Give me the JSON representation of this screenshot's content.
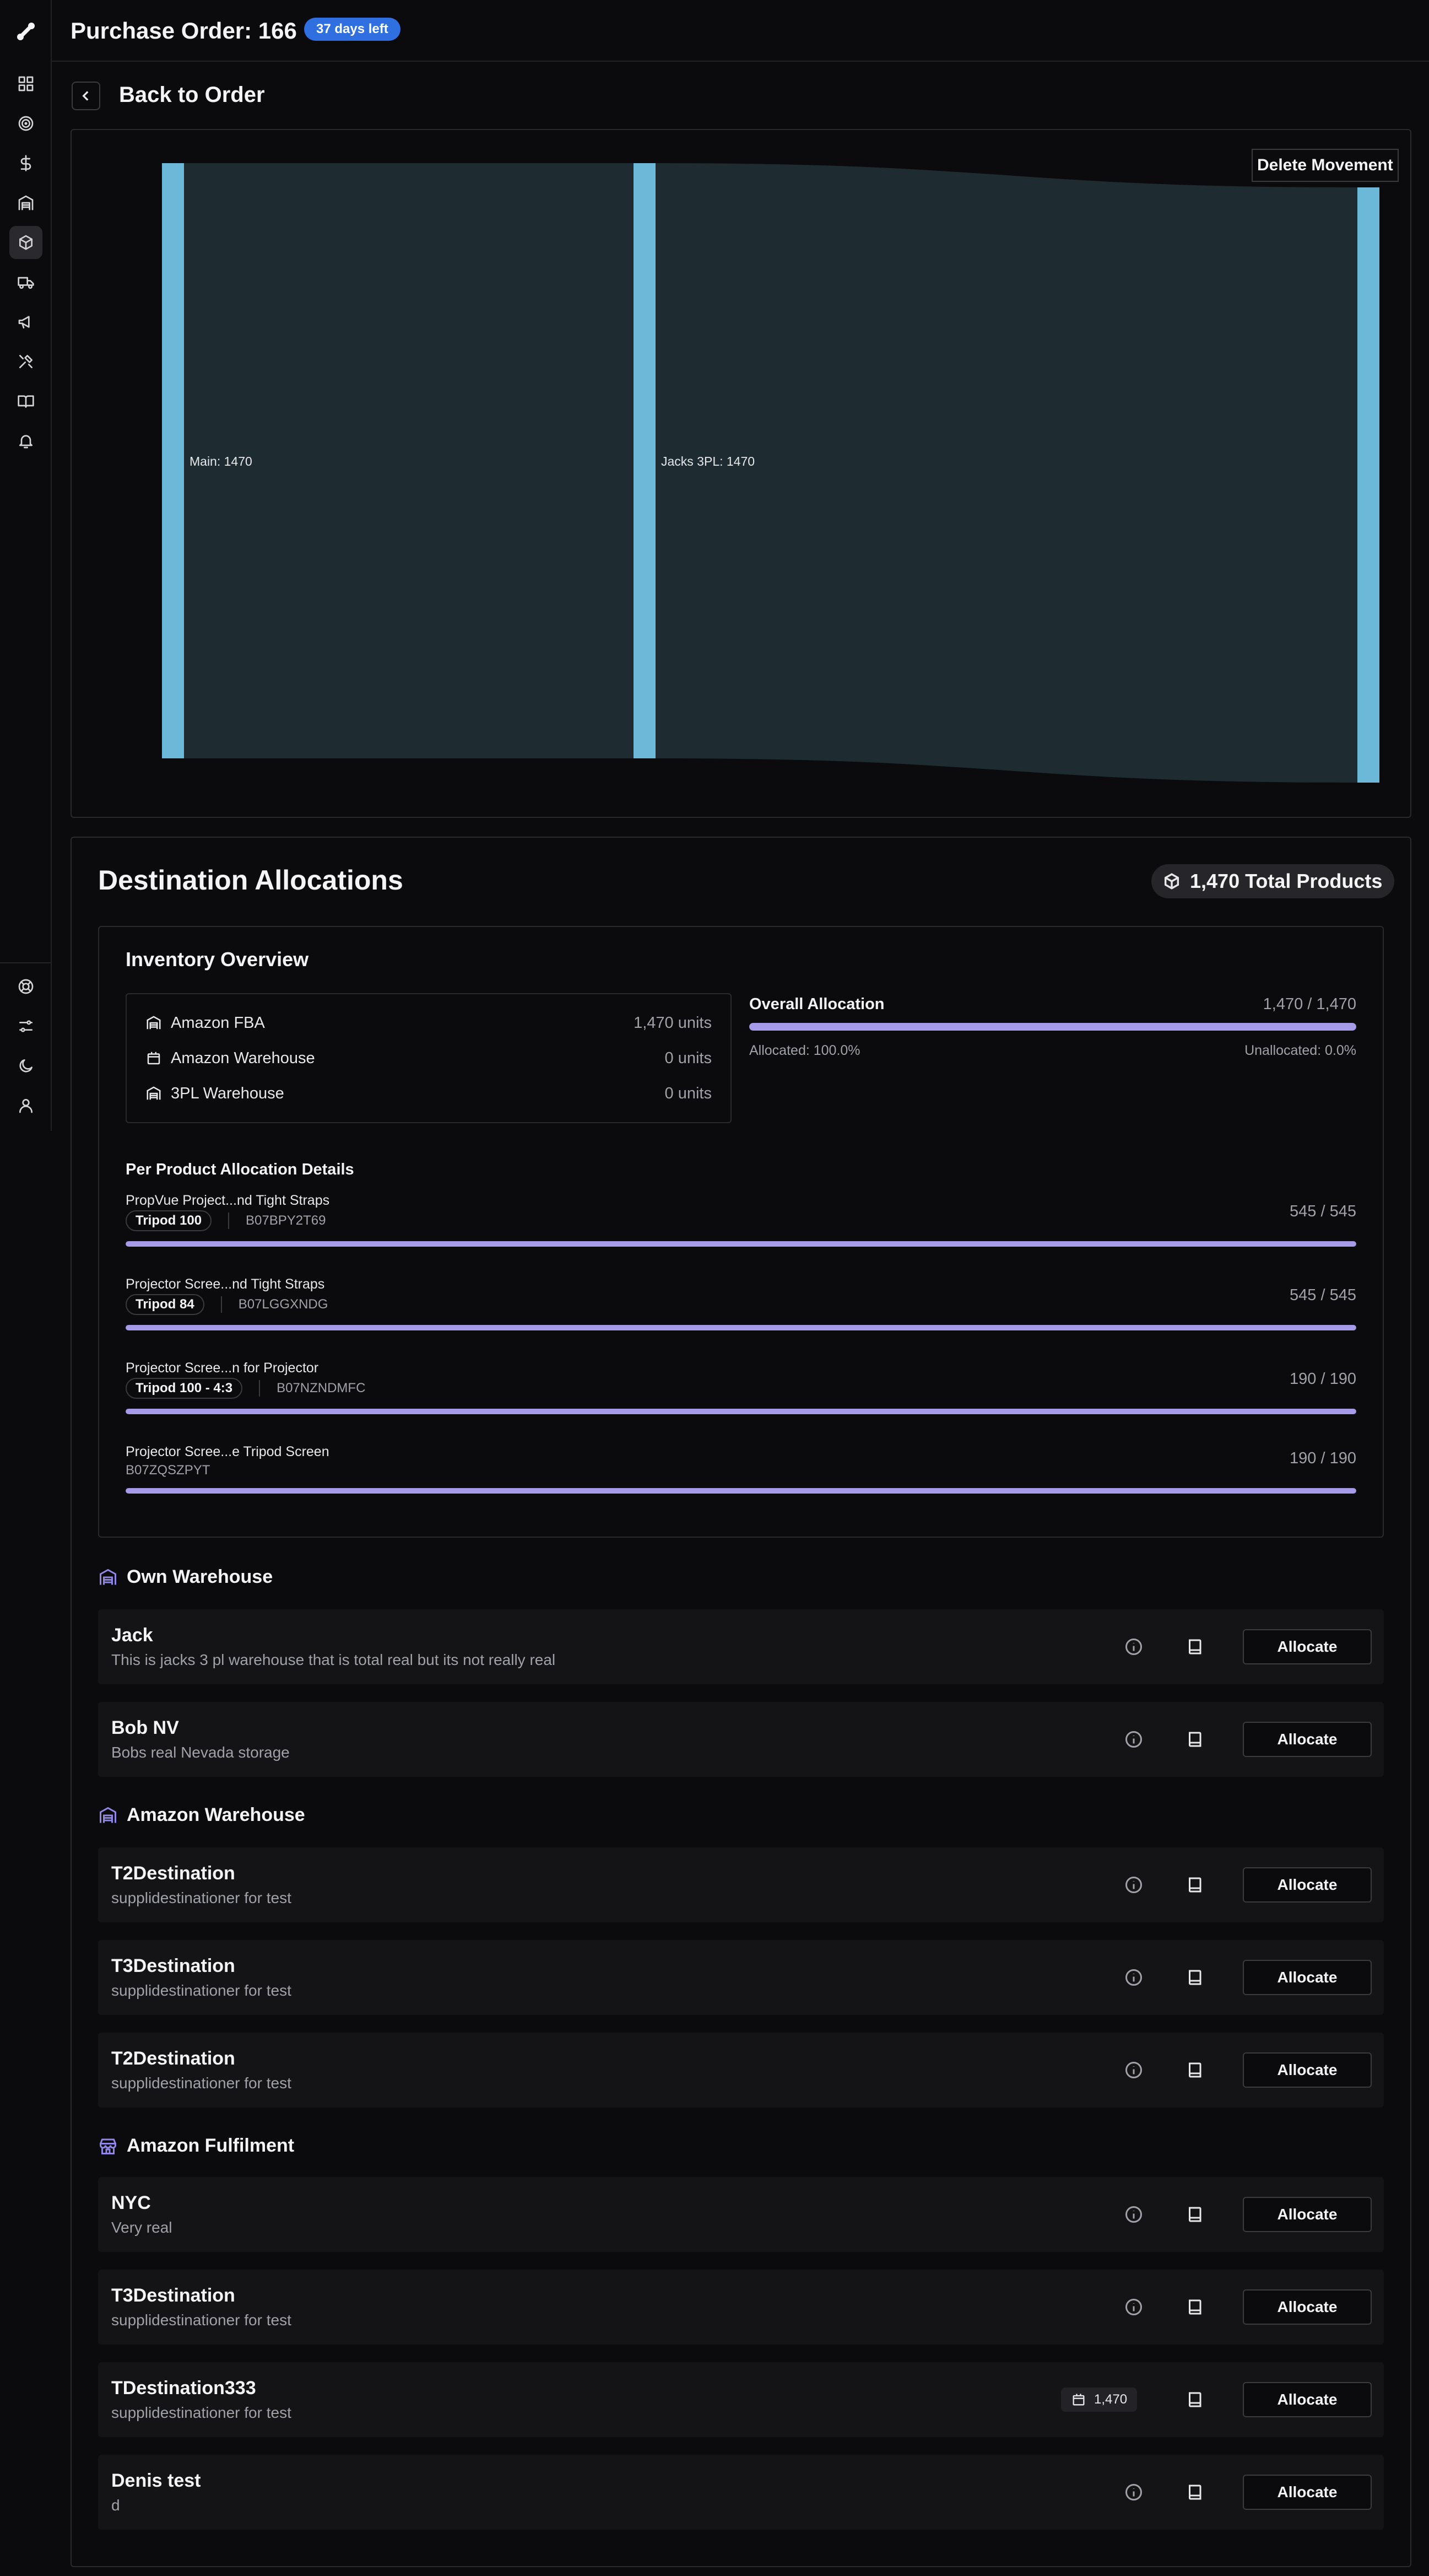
{
  "header": {
    "title": "Purchase Order: 166",
    "badge": "37 days left"
  },
  "back": {
    "label": "Back to Order"
  },
  "sankey": {
    "delete_label": "Delete Movement",
    "nodes": [
      {
        "name": "Main",
        "value": 1470,
        "label": "Main: 1470"
      },
      {
        "name": "Jacks 3PL",
        "value": 1470,
        "label": "Jacks 3PL: 1470"
      },
      {
        "name": "",
        "value": 1470,
        "label": ""
      }
    ],
    "colors": {
      "node": "#6cb8d8",
      "link": "#1e2b30"
    }
  },
  "allocations": {
    "title": "Destination Allocations",
    "total_label": "1,470 Total Products",
    "overview": {
      "title": "Inventory Overview",
      "warehouses": [
        {
          "icon": "warehouse-icon",
          "name": "Amazon FBA",
          "value": "1,470 units"
        },
        {
          "icon": "box-icon",
          "name": "Amazon Warehouse",
          "value": "0 units"
        },
        {
          "icon": "warehouse-icon",
          "name": "3PL Warehouse",
          "value": "0 units"
        }
      ],
      "overall": {
        "label": "Overall Allocation",
        "value": "1,470 / 1,470",
        "fraction": 1.0,
        "allocated": "Allocated: 100.0%",
        "unallocated": "Unallocated: 0.0%"
      }
    },
    "per_product": {
      "title": "Per Product Allocation Details",
      "items": [
        {
          "name": "PropVue Project...nd Tight Straps",
          "tag": "Tripod 100",
          "asin": "B07BPY2T69",
          "count": "545 / 545",
          "fraction": 1.0
        },
        {
          "name": "Projector Scree...nd Tight Straps",
          "tag": "Tripod 84",
          "asin": "B07LGGXNDG",
          "count": "545 / 545",
          "fraction": 1.0
        },
        {
          "name": "Projector Scree...n for Projector",
          "tag": "Tripod 100 - 4:3",
          "asin": "B07NZNDMFC",
          "count": "190 / 190",
          "fraction": 1.0
        },
        {
          "name": "Projector Scree...e Tripod Screen",
          "tag": "",
          "asin": "B07ZQSZPYT",
          "count": "190 / 190",
          "fraction": 1.0
        }
      ]
    },
    "groups": [
      {
        "title": "Own Warehouse",
        "rows": [
          {
            "name": "Jack",
            "desc": "This is jacks 3 pl warehouse that is total real but its not really real"
          },
          {
            "name": "Bob NV",
            "desc": "Bobs real Nevada storage"
          }
        ]
      },
      {
        "title": "Amazon Warehouse",
        "rows": [
          {
            "name": "T2Destination",
            "desc": "supplidestinationer for test"
          },
          {
            "name": "T3Destination",
            "desc": "supplidestinationer for test"
          },
          {
            "name": "T2Destination",
            "desc": "supplidestinationer for test"
          }
        ]
      },
      {
        "title": "Amazon Fulfilment",
        "rows": [
          {
            "name": "NYC",
            "desc": "Very real"
          },
          {
            "name": "T3Destination",
            "desc": "supplidestinationer for test"
          },
          {
            "name": "TDestination333",
            "desc": "supplidestinationer for test",
            "qty": "1,470"
          },
          {
            "name": "Denis test",
            "desc": "d"
          }
        ]
      }
    ],
    "allocate_label": "Allocate"
  }
}
